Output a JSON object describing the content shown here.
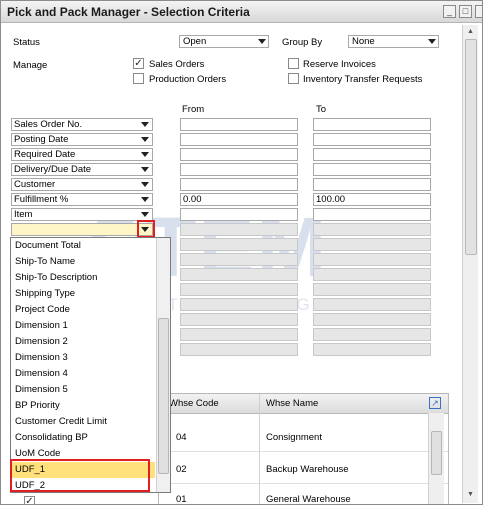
{
  "window": {
    "title": "Pick and Pack Manager - Selection Criteria",
    "buttons": [
      "minimize",
      "maximize",
      "close"
    ]
  },
  "header": {
    "status_label": "Status",
    "status_value": "Open",
    "group_by_label": "Group By",
    "group_by_value": "None",
    "manage_label": "Manage",
    "options": [
      {
        "label": "Sales Orders",
        "checked": true
      },
      {
        "label": "Production Orders",
        "checked": false
      },
      {
        "label": "Reserve Invoices",
        "checked": false
      },
      {
        "label": "Inventory Transfer Requests",
        "checked": false
      }
    ]
  },
  "criteria": {
    "from_label": "From",
    "to_label": "To",
    "rows": [
      {
        "label": "Sales Order No.",
        "from": "",
        "to": ""
      },
      {
        "label": "Posting Date",
        "from": "",
        "to": ""
      },
      {
        "label": "Required Date",
        "from": "",
        "to": ""
      },
      {
        "label": "Delivery/Due Date",
        "from": "",
        "to": ""
      },
      {
        "label": "Customer",
        "from": "",
        "to": ""
      },
      {
        "label": "Fulfillment %",
        "from": "0.00",
        "to": "100.00"
      },
      {
        "label": "Item",
        "from": "",
        "to": ""
      },
      {
        "label": "",
        "from": "",
        "to": ""
      }
    ]
  },
  "dropdown_list": {
    "items": [
      "Document Total",
      "Ship-To Name",
      "Ship-To Description",
      "Shipping Type",
      "Project Code",
      "Dimension 1",
      "Dimension 2",
      "Dimension 3",
      "Dimension 4",
      "Dimension 5",
      "BP Priority",
      "Customer Credit Limit",
      "Consolidating BP",
      "UoM Code",
      "UDF_1",
      "UDF_2"
    ],
    "highlighted": [
      "UDF_1"
    ]
  },
  "warehouse_table": {
    "columns": [
      "Whse Code",
      "Whse Name"
    ],
    "rows": [
      {
        "code": "04",
        "name": "Consignment"
      },
      {
        "code": "02",
        "name": "Backup Warehouse"
      },
      {
        "code": "01",
        "name": "General Warehouse"
      }
    ]
  },
  "watermark": {
    "big": "STEM",
    "small": "INNOVATION • DESIGN • VALUE"
  },
  "colors": {
    "highlight": "#ffe07a",
    "annotation_red": "#e02020",
    "watermark": "#b9c7e0"
  }
}
